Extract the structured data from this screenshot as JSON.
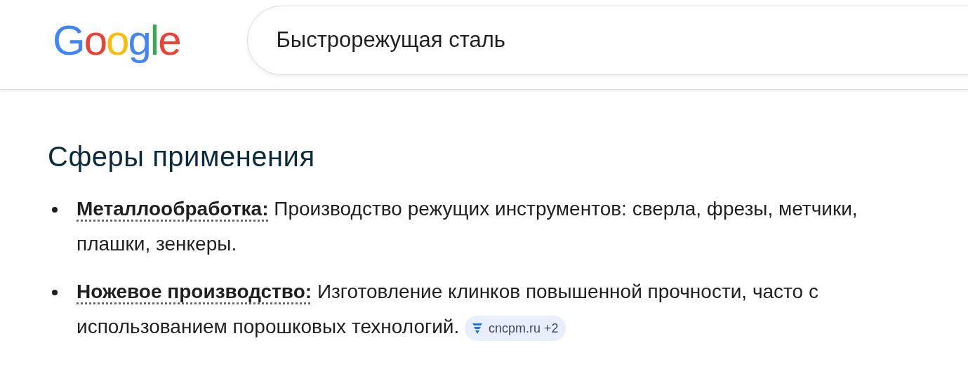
{
  "header": {
    "logo": "Google",
    "search": {
      "value": "Быстрорежущая сталь"
    }
  },
  "section": {
    "heading": "Сферы применения",
    "items": [
      {
        "term": "Металлообработка:",
        "text": "Производство режущих инструментов: сверла, фрезы, метчики, плашки, зенкеры."
      },
      {
        "term": "Ножевое производство:",
        "text": "Изготовление клинков повышенной прочности, часто с использованием порошковых технологий.",
        "source": {
          "label": "cncpm.ru +2"
        }
      }
    ]
  }
}
